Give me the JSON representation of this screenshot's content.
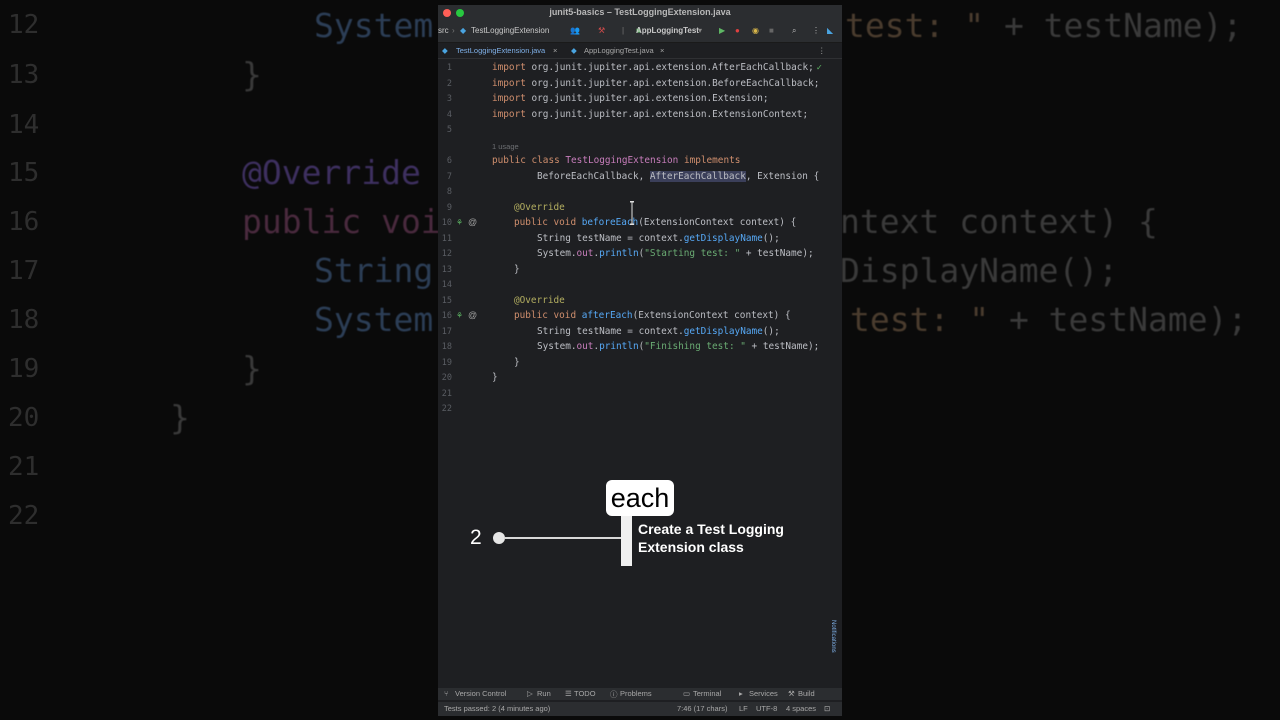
{
  "window": {
    "title": "junit5-basics – TestLoggingExtension.java"
  },
  "toolbar": {
    "breadcrumb_src": "src",
    "breadcrumb_file": "TestLoggingExtension",
    "run_config": "AppLoggingTest"
  },
  "tabs": [
    {
      "label": "TestLoggingExtension.java",
      "active": true
    },
    {
      "label": "AppLoggingTest.java",
      "active": false
    }
  ],
  "editor": {
    "usage_hint": "1 usage",
    "lines": [
      {
        "n": "1"
      },
      {
        "n": "2"
      },
      {
        "n": "3"
      },
      {
        "n": "4"
      },
      {
        "n": "5"
      },
      {
        "n": "6"
      },
      {
        "n": "7"
      },
      {
        "n": "8"
      },
      {
        "n": "9"
      },
      {
        "n": "10"
      },
      {
        "n": "11"
      },
      {
        "n": "12"
      },
      {
        "n": "13"
      },
      {
        "n": "14"
      },
      {
        "n": "15"
      },
      {
        "n": "16"
      },
      {
        "n": "17"
      },
      {
        "n": "18"
      },
      {
        "n": "19"
      },
      {
        "n": "20"
      },
      {
        "n": "21"
      },
      {
        "n": "22"
      }
    ],
    "code": {
      "l1_kw": "import",
      "l1": " org.junit.jupiter.api.extension.AfterEachCallback;",
      "l2_kw": "import",
      "l2": " org.junit.jupiter.api.extension.BeforeEachCallback;",
      "l3_kw": "import",
      "l3": " org.junit.jupiter.api.extension.Extension;",
      "l4_kw": "import",
      "l4": " org.junit.jupiter.api.extension.ExtensionContext;",
      "l6_kw": "public class",
      "l6_cls": "TestLoggingExtension",
      "l6_impl": "implements",
      "l7_a": "BeforeEachCallback, ",
      "l7_hl": "AfterEachCallback",
      "l7_b": ", Extension {",
      "l9_ann": "@Override",
      "l10_kw": "public void",
      "l10_fn": "beforeEach",
      "l10_rest": "(ExtensionContext context) {",
      "l11_a": "String testName = context.",
      "l11_fn": "getDisplayName",
      "l11_b": "();",
      "l12_a": "System.",
      "l12_fld": "out",
      "l12_b": ".",
      "l12_fn": "println",
      "l12_c": "(",
      "l12_str": "\"Starting test: \"",
      "l12_d": " + testName);",
      "l13": "}",
      "l15_ann": "@Override",
      "l16_kw": "public void",
      "l16_fn": "afterEach",
      "l16_rest": "(ExtensionContext context) {",
      "l17_a": "String testName = context.",
      "l17_fn": "getDisplayName",
      "l17_b": "();",
      "l18_a": "System.",
      "l18_fld": "out",
      "l18_b": ".",
      "l18_fn": "println",
      "l18_c": "(",
      "l18_str": "\"Finishing test: \"",
      "l18_d": " + testName);",
      "l19": "}",
      "l20": "}"
    }
  },
  "bottom_tools": {
    "version_control": "Version Control",
    "run": "Run",
    "todo": "TODO",
    "problems": "Problems",
    "terminal": "Terminal",
    "services": "Services",
    "build": "Build"
  },
  "status": {
    "left": "Tests passed: 2 (4 minutes ago)",
    "position": "7:46 (17 chars)",
    "line_sep": "LF",
    "encoding": "UTF-8",
    "indent": "4 spaces"
  },
  "notifications_label": "Notifications",
  "overlay": {
    "step_number": "2",
    "word": "each",
    "caption": "Create a Test Logging Extension class"
  },
  "background_code": {
    "n12": "12",
    "n13": "13",
    "n14": "14",
    "n15": "15",
    "n16": "16",
    "n17": "17",
    "n18": "18",
    "n19": "19",
    "n20": "20",
    "n21": "21",
    "n22": "22",
    "r12_left": "System.",
    "r12_right_str": "test: \"",
    "r12_right": " + testName);",
    "r13": "}",
    "r15": "@Override",
    "r16_left": "public void",
    "r16_right": "ntext context) {",
    "r17_left": "String",
    "r17_right": "DisplayName();",
    "r18_left": "System.",
    "r18_right_str": "test: \"",
    "r18_right": " + testName);",
    "r19": "}",
    "r20": "}"
  },
  "colors": {
    "editor_bg": "#1e1f22",
    "keyword": "#cf8e6d",
    "annotation": "#b3ae60",
    "string": "#6aab73",
    "function": "#56a8f5"
  }
}
